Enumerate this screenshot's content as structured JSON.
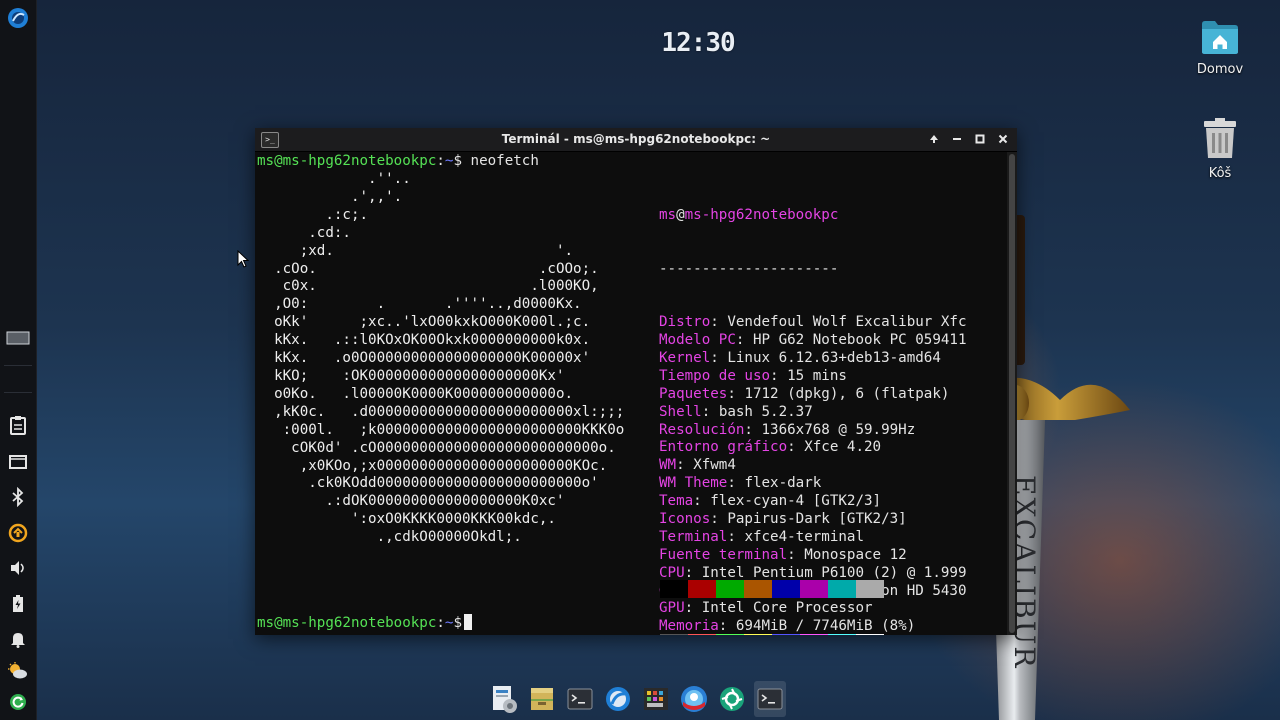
{
  "clock": {
    "time": "12:30"
  },
  "desktop": {
    "icons": [
      {
        "label": "Domov",
        "icon": "home-folder-icon"
      },
      {
        "label": "Kôš",
        "icon": "trash-icon"
      }
    ],
    "sword_text": "EXCALIBUR"
  },
  "terminal": {
    "title": "Terminál - ms@ms-hpg62notebookpc: ~",
    "prompt_user": "ms@ms-hpg62notebookpc",
    "prompt_sep": ":",
    "prompt_dir": "~",
    "prompt_sym": "$",
    "command": " neofetch",
    "ascii_art": "             .''..\n           .',,'.\n        .:c;.\n      .cd:.\n     ;xd.                          '.\n  .cOo.                          .cOOo;.\n   c0x.                         .l000KO,\n  ,O0:        .       .''''..,d0000Kx.\n  oKk'      ;xc..'lxO00kxkO000K000l.;c.\n  kKx.   .::l0KOxOK00Okxk0000000000k0x.\n  kKx.   .o0O000000000000000000K00000x'\n  kKO;    :OK00000000000000000000Kx'\n  o0Ko.   .l00000K0000K000000000000o.\n  ,kK0c.   .d000000000000000000000000xl:;;;\n   :000l.   ;k000000000000000000000000KKK0o\n    cOK0d' .cO00000000000000000000000000o.\n     ,x0KOo,;x00000000000000000000000KOc.\n      .ck0KOdd000000000000000000000000o'\n        .:dOK000000000000000000K0xc'\n           ':oxO0KKKK0000KKK00kdc,.\n              .,cdkO00000Okdl;.",
    "info_user": "ms",
    "info_at": "@",
    "info_host": "ms-hpg62notebookpc",
    "separator": "---------------------",
    "info_rows": [
      {
        "key": "Distro",
        "value": "Vendefoul Wolf Excalibur Xfc"
      },
      {
        "key": "Modelo PC",
        "value": "HP G62 Notebook PC 059411"
      },
      {
        "key": "Kernel",
        "value": "Linux 6.12.63+deb13-amd64"
      },
      {
        "key": "Tiempo de uso",
        "value": "15 mins"
      },
      {
        "key": "Paquetes",
        "value": "1712 (dpkg), 6 (flatpak)"
      },
      {
        "key": "Shell",
        "value": "bash 5.2.37"
      },
      {
        "key": "Resolución",
        "value": "1366x768 @ 59.99Hz"
      },
      {
        "key": "Entorno gráfico",
        "value": "Xfce 4.20"
      },
      {
        "key": "WM",
        "value": "Xfwm4"
      },
      {
        "key": "WM Theme",
        "value": "flex-dark"
      },
      {
        "key": "Tema",
        "value": "flex-cyan-4 [GTK2/3]"
      },
      {
        "key": "Iconos",
        "value": "Papirus-Dark [GTK2/3]"
      },
      {
        "key": "Terminal",
        "value": "xfce4-terminal"
      },
      {
        "key": "Fuente terminal",
        "value": "Monospace 12"
      },
      {
        "key": "CPU",
        "value": "Intel Pentium P6100 (2) @ 1.999"
      },
      {
        "key": "GPU",
        "value": "AMD ATI Mobility Radeon HD 5430"
      },
      {
        "key": "GPU",
        "value": "Intel Core Processor"
      },
      {
        "key": "Memoria",
        "value": "694MiB / 7746MiB (8%)"
      }
    ],
    "palette_dark": [
      "#000000",
      "#aa0000",
      "#00aa00",
      "#aa5500",
      "#0000aa",
      "#aa00aa",
      "#00aaaa",
      "#aaaaaa"
    ],
    "palette_bright": [
      "#555555",
      "#ff5555",
      "#55ff55",
      "#ffff55",
      "#5555ff",
      "#ff55ff",
      "#55ffff",
      "#ffffff"
    ]
  },
  "left_panel": {
    "items": [
      "app-menu-icon",
      "workspace-icon",
      "clipboard-icon",
      "display-icon",
      "bluetooth-icon",
      "update-icon",
      "volume-icon",
      "battery-icon",
      "notification-icon",
      "weather-icon",
      "power-icon"
    ]
  },
  "dock": {
    "items": [
      "file-manager-icon",
      "archive-icon",
      "terminal-icon",
      "browser-icon",
      "color-picker-icon",
      "web-browser-icon",
      "screenshot-icon",
      "terminal-active-icon"
    ]
  }
}
